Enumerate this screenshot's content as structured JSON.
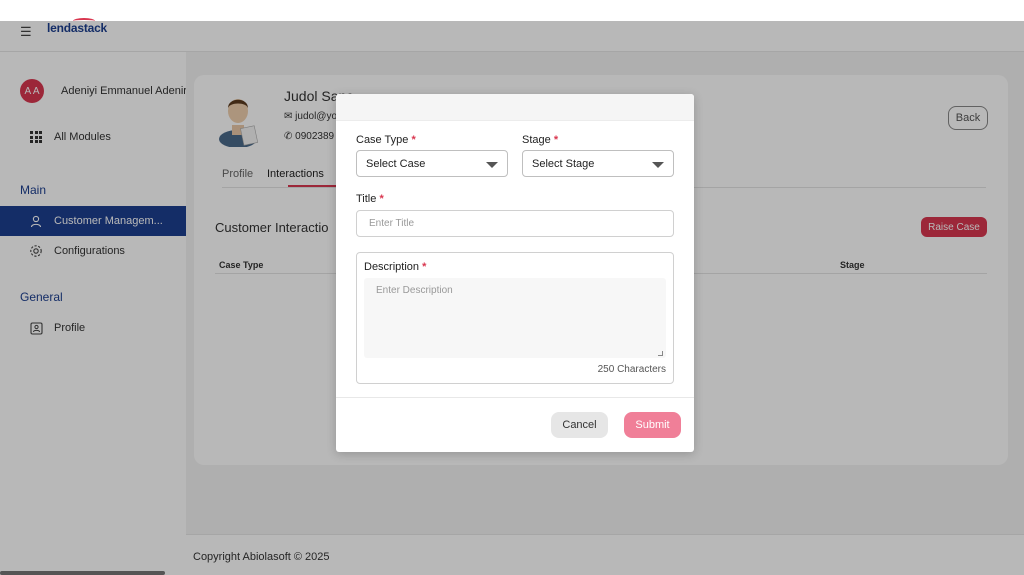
{
  "app": {
    "logo_text": "lendastack",
    "brand_color": "#1d3f8f",
    "accent_color": "#d9364f"
  },
  "sidebar": {
    "user_initials": "A A",
    "user_name": "Adeniyi Emmanuel Adeniran",
    "all_modules": "All Modules",
    "section_main": "Main",
    "section_general": "General",
    "items": [
      {
        "label": "Customer Managem...",
        "icon": "person-icon"
      },
      {
        "label": "Configurations",
        "icon": "gear-icon"
      },
      {
        "label": "Profile",
        "icon": "profile-card-icon"
      }
    ]
  },
  "customer": {
    "name": "Judol Sanc",
    "email": "judol@yo",
    "phone": "0902389"
  },
  "page": {
    "back_label": "Back",
    "tabs": [
      "Profile",
      "Interactions"
    ],
    "section_title": "Customer Interactio",
    "raise_case_label": "Raise Case",
    "table_headers": [
      "Case Type",
      "Stage"
    ]
  },
  "footer": {
    "copyright": "Copyright Abiolasoft © 2025"
  },
  "modal": {
    "case_type_label": "Case Type",
    "case_type_value": "Select Case",
    "stage_label": "Stage",
    "stage_value": "Select Stage",
    "title_label": "Title",
    "title_placeholder": "Enter Title",
    "description_label": "Description",
    "description_placeholder": "Enter Description",
    "char_count": "250 Characters",
    "cancel_label": "Cancel",
    "submit_label": "Submit",
    "required_marker": "*"
  }
}
